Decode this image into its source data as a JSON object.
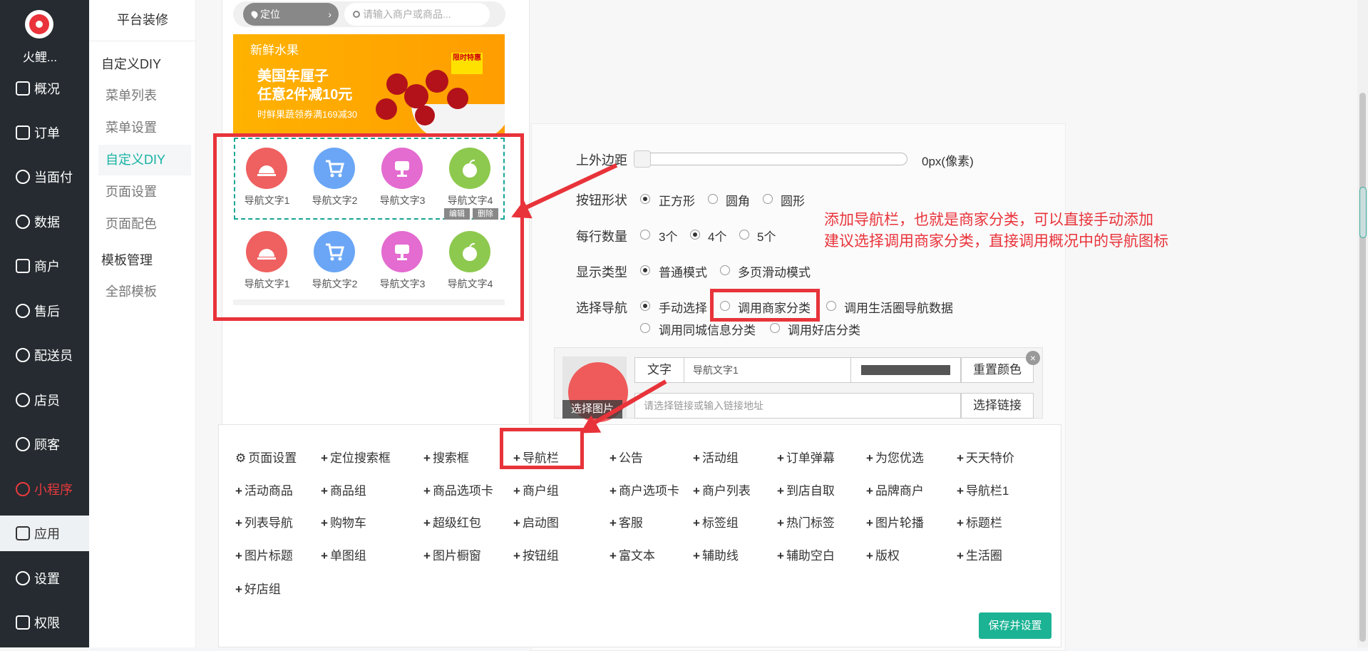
{
  "app": {
    "brand": "火鲤..."
  },
  "sidebar": {
    "items": [
      {
        "label": "概况",
        "icon": "dashboard-icon"
      },
      {
        "label": "订单",
        "icon": "order-icon"
      },
      {
        "label": "当面付",
        "icon": "yen-icon"
      },
      {
        "label": "数据",
        "icon": "chart-icon"
      },
      {
        "label": "商户",
        "icon": "store-icon"
      },
      {
        "label": "售后",
        "icon": "headset-icon"
      },
      {
        "label": "配送员",
        "icon": "courier-icon"
      },
      {
        "label": "店员",
        "icon": "clerk-icon"
      },
      {
        "label": "顾客",
        "icon": "customer-icon"
      },
      {
        "label": "小程序",
        "icon": "miniprogram-icon"
      },
      {
        "label": "应用",
        "icon": "app-icon"
      },
      {
        "label": "设置",
        "icon": "gear-icon"
      },
      {
        "label": "权限",
        "icon": "lock-icon"
      }
    ]
  },
  "subnav": {
    "title": "平台装修",
    "section1": "自定义DIY",
    "items1": [
      "菜单列表",
      "菜单设置",
      "自定义DIY",
      "页面设置",
      "页面配色"
    ],
    "section2": "模板管理",
    "items2": [
      "全部模板"
    ]
  },
  "phone": {
    "location": "定位",
    "search_placeholder": "请输入商户或商品...",
    "banner": {
      "tag": "新鲜水果",
      "line1": "美国车厘子",
      "line2": "任意2件减10元",
      "line3": "时鲜果蔬领券满169减30",
      "badge": "限时特惠"
    },
    "nav_items": [
      "导航文字1",
      "导航文字2",
      "导航文字3",
      "导航文字4"
    ],
    "edit": "编辑",
    "delete": "删除"
  },
  "panel": {
    "margin_label": "上外边距",
    "margin_value": "0px(像素)",
    "shape_label": "按钮形状",
    "shape_options": [
      "正方形",
      "圆角",
      "圆形"
    ],
    "per_row_label": "每行数量",
    "per_row_options": [
      "3个",
      "4个",
      "5个"
    ],
    "display_label": "显示类型",
    "display_options": [
      "普通模式",
      "多页滑动模式"
    ],
    "source_label": "选择导航",
    "source_options": [
      "手动选择",
      "调用商家分类",
      "调用生活圈导航数据",
      "调用同城信息分类",
      "调用好店分类"
    ],
    "item": {
      "choose_image": "选择图片",
      "text_label": "文字",
      "text_value": "导航文字1",
      "reset_color": "重置颜色",
      "link_placeholder": "请选择链接或输入链接地址",
      "choose_link": "选择链接"
    }
  },
  "annotation": {
    "line1": "添加导航栏，也就是商家分类，可以直接手动添加",
    "line2": "建议选择调用商家分类，直接调用概况中的导航图标"
  },
  "components": [
    "页面设置",
    "定位搜索框",
    "搜索框",
    "导航栏",
    "公告",
    "活动组",
    "订单弹幕",
    "为您优选",
    "天天特价",
    "活动商品",
    "商品组",
    "商品选项卡",
    "商户组",
    "商户选项卡",
    "商户列表",
    "到店自取",
    "品牌商户",
    "导航栏1",
    "列表导航",
    "购物车",
    "超级红包",
    "启动图",
    "客服",
    "标签组",
    "热门标签",
    "图片轮播",
    "标题栏",
    "图片标题",
    "单图组",
    "图片橱窗",
    "按钮组",
    "富文本",
    "辅助线",
    "辅助空白",
    "版权",
    "生活圈",
    "好店组"
  ],
  "save_label": "保存并设置",
  "colors": {
    "sidebar": "#252b30",
    "accent": "#17b3a3",
    "highlight": "#e8333a",
    "save": "#1bb394"
  }
}
